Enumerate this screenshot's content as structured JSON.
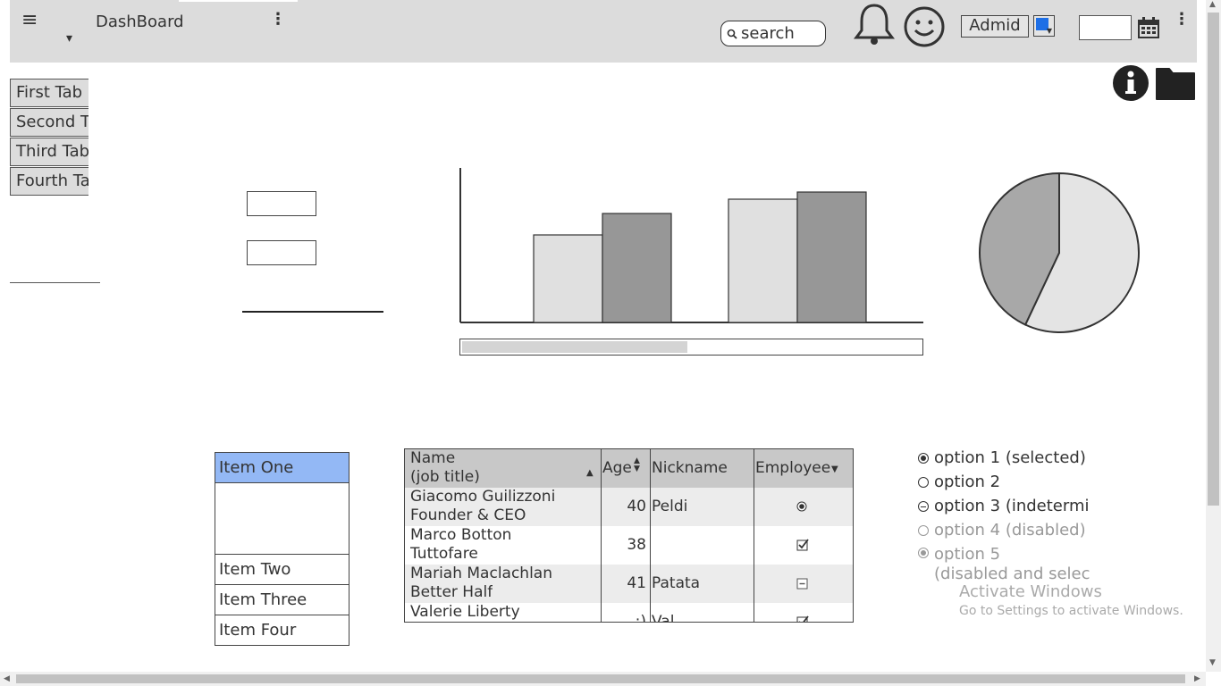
{
  "header": {
    "menu_glyph": "≡",
    "dropdown_glyph": "▾",
    "title": "DashBoard",
    "kebab_glyph": "⋮",
    "search_placeholder": "search",
    "admin_label": "Admid",
    "accent_color": "#1e6fe6",
    "icons": [
      "menu-icon",
      "search-icon",
      "bell-icon",
      "smiley-icon",
      "calendar-icon",
      "kebab-icon"
    ]
  },
  "side_icons": [
    "info-icon",
    "folder-icon"
  ],
  "tabs": [
    "First Tab",
    "Second Tab",
    "Third Tab",
    "Fourth Tab"
  ],
  "list": {
    "items": [
      "Item One",
      "Item Two",
      "Item Three",
      "Item Four"
    ],
    "selected_color": "#93b8f5"
  },
  "progress": {
    "fraction": 0.49
  },
  "chart_data": [
    {
      "type": "bar",
      "categories": [
        "",
        ""
      ],
      "series": [
        {
          "values": [
            49,
            69
          ]
        },
        {
          "values": [
            61,
            73
          ]
        }
      ],
      "ylim": [
        0,
        100
      ],
      "colors": [
        "#e0e0e0",
        "#979797"
      ]
    },
    {
      "type": "pie",
      "values": [
        57,
        43
      ],
      "colors": [
        "#e4e4e4",
        "#a8a8a8"
      ]
    }
  ],
  "table": {
    "headers": {
      "name_line1": "Name",
      "name_line2": "(job title)",
      "age": "Age",
      "nickname": "Nickname",
      "employee": "Employee"
    },
    "rows": [
      {
        "name": "Giacomo Guilizzoni",
        "title": "Founder & CEO",
        "age": "40",
        "nickname": "Peldi",
        "employee": "radio"
      },
      {
        "name": "Marco Botton",
        "title": "Tuttofare",
        "age": "38",
        "nickname": "",
        "employee": "checked"
      },
      {
        "name": "Mariah Maclachlan",
        "title": "Better Half",
        "age": "41",
        "nickname": "Patata",
        "employee": "indeterminate"
      },
      {
        "name": "Valerie Liberty",
        "title": "",
        "age": ":)",
        "nickname": "Val",
        "employee": "checked"
      }
    ]
  },
  "radios": [
    {
      "label": "option 1 (selected)",
      "state": "selected",
      "disabled": false
    },
    {
      "label": "option 2",
      "state": "none",
      "disabled": false
    },
    {
      "label": "option 3 (indetermi",
      "state": "indeterminate",
      "disabled": false
    },
    {
      "label": "option 4 (disabled)",
      "state": "none",
      "disabled": true
    },
    {
      "label": "option 5",
      "label2": "(disabled and selec",
      "state": "selected",
      "disabled": true
    }
  ],
  "watermark": {
    "title": "Activate Windows",
    "subtitle": "Go to Settings to activate Windows."
  }
}
